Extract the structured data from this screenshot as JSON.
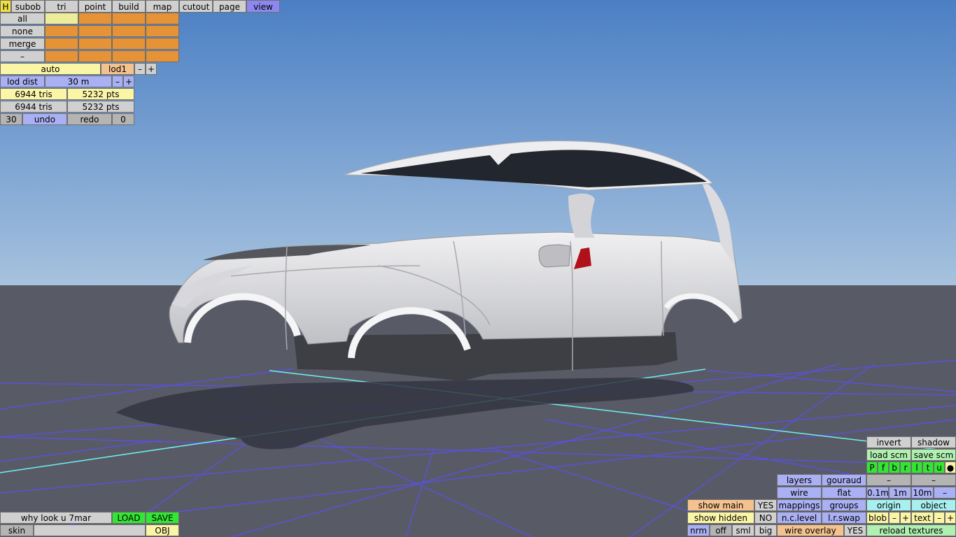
{
  "top_tabs": {
    "h": "H",
    "items": [
      "subob",
      "tri",
      "point",
      "build",
      "map",
      "cutout",
      "page",
      "view"
    ],
    "active": "view"
  },
  "select_menu": {
    "items": [
      "all",
      "none",
      "merge",
      "–"
    ]
  },
  "lod": {
    "mode": "auto",
    "level": "lod1",
    "minus": "–",
    "plus": "+",
    "dist_label": "lod dist",
    "dist_value": "30 m"
  },
  "stats": {
    "row1_tris": "6944 tris",
    "row1_pts": "5232 pts",
    "row2_tris": "6944 tris",
    "row2_pts": "5232 pts"
  },
  "history": {
    "count": "30",
    "undo": "undo",
    "redo": "redo",
    "redo_count": "0"
  },
  "file_panel": {
    "name": "why look u 7mar",
    "load": "LOAD",
    "save": "SAVE",
    "skin": "skin",
    "obj": "OBJ"
  },
  "display_panel": {
    "invert": "invert",
    "shadow": "shadow",
    "load_scm": "load scm",
    "save_scm": "save scm",
    "flags": [
      "P",
      "f",
      "b",
      "r",
      "l",
      "t",
      "u",
      "●"
    ],
    "layers": "layers",
    "gouraud": "gouraud",
    "dash1": "–",
    "dash2": "–",
    "wire": "wire",
    "flat": "flat",
    "step1": "0.1m",
    "step2": "1m",
    "step3": "10m",
    "step_minus": "–",
    "show_main": "show main",
    "show_main_val": "YES",
    "mappings": "mappings",
    "groups": "groups",
    "origin": "origin",
    "object": "object",
    "show_hidden": "show hidden",
    "show_hidden_val": "NO",
    "nc_level": "n.c.level",
    "lr_swap": "l.r.swap",
    "blob": "blob",
    "text": "text",
    "minus": "–",
    "plus": "+",
    "nrm": "nrm",
    "off": "off",
    "sml": "sml",
    "big": "big",
    "wire_overlay": "wire overlay",
    "wire_overlay_val": "YES",
    "reload_textures": "reload textures"
  },
  "colors": {
    "sky_top": "#4b7fc4",
    "sky_bottom": "#a6c2de",
    "ground": "#585b66",
    "grid": "#5a4ef0",
    "grid_axis": "#6ff0f0",
    "body": "#e0e0e2",
    "active_tab": "#8c88f0"
  }
}
